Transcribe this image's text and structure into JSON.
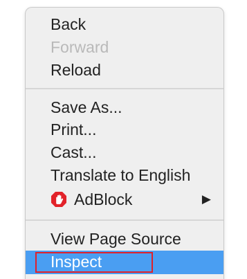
{
  "context_menu": {
    "back": "Back",
    "forward": "Forward",
    "reload": "Reload",
    "save_as": "Save As...",
    "print": "Print...",
    "cast": "Cast...",
    "translate": "Translate to English",
    "adblock": {
      "label": "AdBlock",
      "icon": "adblock-stop-hand-icon",
      "icon_color": "#e2232a",
      "submenu_arrow": "▶"
    },
    "view_source": "View Page Source",
    "inspect": "Inspect"
  },
  "colors": {
    "highlight": "#4a9ef2",
    "annotation_box": "#e0202a"
  }
}
